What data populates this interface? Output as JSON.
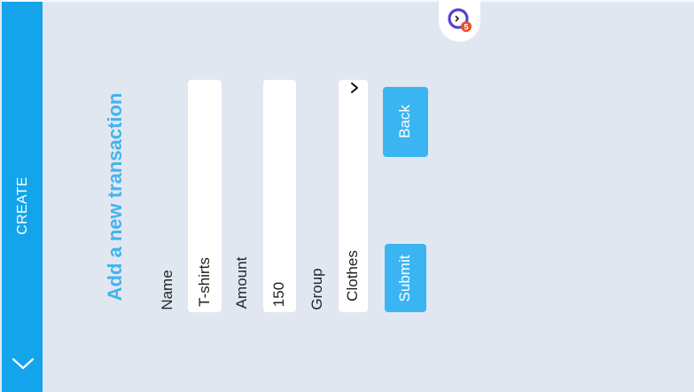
{
  "sidebar": {
    "title": "CREATE",
    "collapse_icon": "chevron-down-icon"
  },
  "fab": {
    "icon": "stopwatch-icon",
    "badge": "5"
  },
  "form": {
    "title": "Add a new transaction",
    "name": {
      "label": "Name",
      "value": "T-shirts"
    },
    "amount": {
      "label": "Amount",
      "value": "150"
    },
    "group": {
      "label": "Group",
      "value": "Clothes",
      "icon": "chevron-down-icon"
    },
    "back_label": "Back",
    "submit_label": "Submit"
  },
  "colors": {
    "sidebar": "#13a4ec",
    "accent": "#42b4ee",
    "button": "#3ab5f2",
    "background": "#e1e7f1",
    "badge": "#f04e23"
  }
}
